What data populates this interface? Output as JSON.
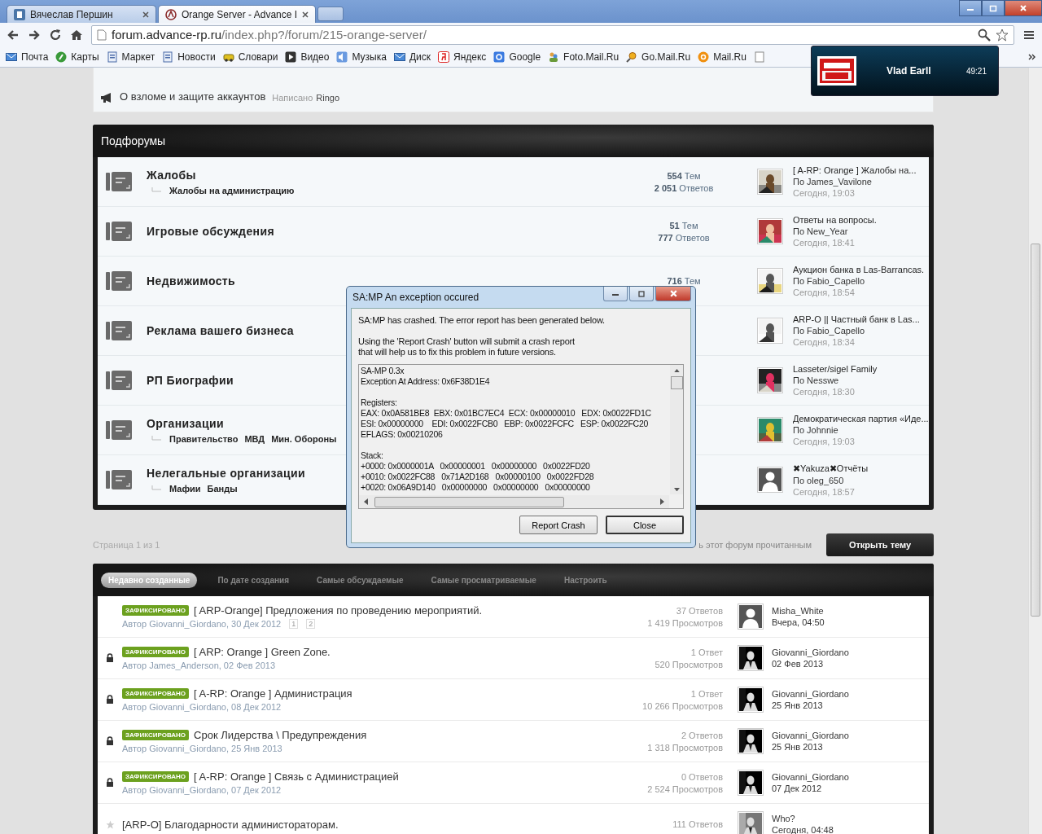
{
  "browser": {
    "tabs": [
      {
        "title": "Вячеслав Першин",
        "selected": false
      },
      {
        "title": "Orange Server - Advance I",
        "selected": true
      }
    ],
    "url_host": "forum.advance-rp.ru",
    "url_path": "/index.php?/forum/215-orange-server/",
    "bookmarks": [
      "Почта",
      "Карты",
      "Маркет",
      "Новости",
      "Словари",
      "Видео",
      "Музыка",
      "Диск",
      "Яндекс",
      "Google",
      "Foto.Mail.Ru",
      "Go.Mail.Ru",
      "Mail.Ru"
    ]
  },
  "notification": {
    "name": "Vlad Earll",
    "time": "49:21"
  },
  "announcement": {
    "title": "О взломе и защите аккаунтов",
    "label": "Написано",
    "author": "Ringo"
  },
  "subforums": {
    "title": "Подфорумы",
    "rows": [
      {
        "name": "Жалобы",
        "subs": [
          "Жалобы на администрацию"
        ],
        "topics": "**554** Тем",
        "replies": "**2 051** Ответов",
        "last": {
          "title": "[ A-RP: Orange ] Жалобы на...",
          "by": "По James_Vavilone",
          "time": "Сегодня, 19:03"
        }
      },
      {
        "name": "Игровые обсуждения",
        "topics": "**51** Тем",
        "replies": "**777** Ответов",
        "last": {
          "title": "Ответы на вопросы.",
          "by": "По New_Year",
          "time": "Сегодня, 18:41"
        }
      },
      {
        "name": "Недвижимость",
        "topics": "**716** Тем",
        "last": {
          "title": "Аукцион банка в Las-Barrancas.",
          "by": "По Fabio_Capello",
          "time": "Сегодня, 18:54"
        }
      },
      {
        "name": "Реклама вашего бизнеса",
        "last": {
          "title": "ARP-O || Частный банк в Las...",
          "by": "По Fabio_Capello",
          "time": "Сегодня, 18:34"
        }
      },
      {
        "name": "РП Биографии",
        "last": {
          "title": "Lasseter/sigel Family",
          "by": "По Nesswe",
          "time": "Сегодня, 18:30"
        }
      },
      {
        "name": "Организации",
        "subs": [
          "Правительство",
          "МВД",
          "Мин. Обороны"
        ],
        "last": {
          "title": "Демократическая партия «Иде...",
          "by": "По Johnnie",
          "time": "Сегодня, 19:03"
        }
      },
      {
        "name": "Нелегальные организации",
        "subs": [
          "Мафии",
          "Банды"
        ],
        "last": {
          "title": "✖Yakuza✖Отчёты",
          "by": "По oleg_650",
          "time": "Сегодня, 18:57",
          "kind": "silhouette"
        }
      }
    ]
  },
  "pager": {
    "pages": "Страница 1 из 1",
    "mark_read": "ь этот форум прочитанным",
    "new_topic": "Открыть тему"
  },
  "topics": {
    "tabs": [
      {
        "label": "Недавно созданные",
        "selected": true
      },
      {
        "label": "По дате создания",
        "selected": false
      },
      {
        "label": "Самые обсуждаемые",
        "selected": false
      },
      {
        "label": "Самые просматриваемые",
        "selected": false
      },
      {
        "label": "Настроить",
        "selected": false
      }
    ],
    "rows": [
      {
        "badge": "ЗАФИКСИРОВАНО",
        "title": "[ ARP-Orange] Предложения по проведению мероприятий.",
        "meta": "Автор Giovanni_Giordano, 30 Дек 2012",
        "pages": [
          "1",
          "2"
        ],
        "replies": "37 Ответов",
        "views": "1 419 Просмотров",
        "user": "Misha_White",
        "time": "Вчера, 04:50",
        "avatar": {
          "kind": "silhouette"
        }
      },
      {
        "kind": "locked",
        "badge": "ЗАФИКСИРОВАНО",
        "title": "[ ARP: Orange ] Green Zone.",
        "meta": "Автор James_Anderson, 02 Фев 2013",
        "replies": "1 Ответ",
        "views": "520 Просмотров",
        "user": "Giovanni_Giordano",
        "time": "02 Фев 2013"
      },
      {
        "kind": "locked",
        "badge": "ЗАФИКСИРОВАНО",
        "title": "[ A-RP: Orange ] Администрация",
        "meta": "Автор Giovanni_Giordano, 08 Дек 2012",
        "replies": "1 Ответ",
        "views": "10 266 Просмотров",
        "user": "Giovanni_Giordano",
        "time": "25 Янв 2013"
      },
      {
        "kind": "locked",
        "badge": "ЗАФИКСИРОВАНО",
        "title": "Срок Лидерства \\ Предупреждения",
        "meta": "Автор Giovanni_Giordano, 25 Янв 2013",
        "replies": "2 Ответов",
        "views": "1 318 Просмотров",
        "user": "Giovanni_Giordano",
        "time": "25 Янв 2013"
      },
      {
        "kind": "locked",
        "badge": "ЗАФИКСИРОВАНО",
        "title": "[ A-RP: Orange ] Связь с Администрацией",
        "meta": "Автор Giovanni_Giordano, 07 Дек 2012",
        "replies": "0 Ответов",
        "views": "2 524 Просмотров",
        "user": "Giovanni_Giordano",
        "time": "07 Дек 2012"
      },
      {
        "kind": "starred",
        "title": "[ARP-O] Благодарности администораторам.",
        "replies": "111 Ответов",
        "user": "Who?",
        "time": "Сегодня, 04:48"
      }
    ]
  },
  "dialog": {
    "title": "SA:MP An exception occured",
    "message": "SA:MP has crashed. The error report has been generated below.",
    "note": [
      "Using the 'Report Crash' button will submit a crash report",
      "that will help us to fix this problem in future versions."
    ],
    "report": [
      [
        "SA-MP 0.3x",
        "Exception At Address: 0x6F38D1E4"
      ],
      [
        "Registers:",
        "EAX: 0x0A581BE8  EBX: 0x01BC7EC4  ECX: 0x00000010   EDX: 0x0022FD1C",
        "ESI: 0x00000000    EDI: 0x0022FCB0   EBP: 0x0022FCFC   ESP: 0x0022FC20",
        "EFLAGS: 0x00210206"
      ],
      [
        "Stack:",
        "+0000: 0x0000001A   0x00000001   0x00000000   0x0022FD20",
        "+0010: 0x0022FC88   0x71A2D168   0x00000100   0x0022FD28",
        "+0020: 0x06A9D140   0x00000000   0x00000000   0x00000000"
      ]
    ],
    "buttons": [
      {
        "label": "Report Crash",
        "selected": false
      },
      {
        "label": "Close",
        "selected": true
      }
    ]
  }
}
